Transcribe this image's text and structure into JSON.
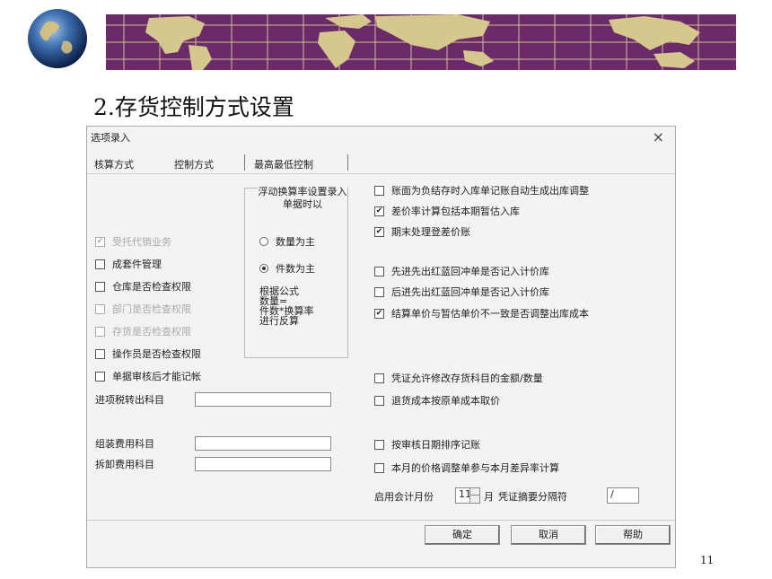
{
  "slide": {
    "title": "2.存货控制方式设置",
    "page_number": "11"
  },
  "dialog": {
    "title": "选项录入",
    "close_glyph": "×",
    "tabs": [
      "核算方式",
      "控制方式",
      "最高最低控制"
    ],
    "active_tab": "控制方式",
    "group_title": "浮动换算率设置录入单据时以",
    "radios": [
      {
        "label": "数量为主",
        "checked": false
      },
      {
        "label": "件数为主",
        "checked": true
      }
    ],
    "formula_text": [
      "根据公式",
      "数量=",
      "件数*换算率",
      "进行反算"
    ],
    "left_checkboxes": [
      {
        "label": "受托代销业务",
        "checked": true,
        "disabled": true
      },
      {
        "label": "成套件管理",
        "checked": false,
        "disabled": false
      },
      {
        "label": "仓库是否检查权限",
        "checked": false,
        "disabled": false
      },
      {
        "label": "部门是否检查权限",
        "checked": false,
        "disabled": true
      },
      {
        "label": "存货是否检查权限",
        "checked": false,
        "disabled": true
      },
      {
        "label": "操作员是否检查权限",
        "checked": false,
        "disabled": false
      },
      {
        "label": "单据审核后才能记帐",
        "checked": false,
        "disabled": false
      }
    ],
    "fields": {
      "tax_transfer_label": "进项税转出科目",
      "assembly_fee_label": "组装费用科目",
      "disassembly_fee_label": "拆卸费用科目"
    },
    "right_checkboxes": [
      {
        "label": "账面为负结存时入库单记账自动生成出库调整",
        "checked": false
      },
      {
        "label": "差价率计算包括本期暂估入库",
        "checked": true
      },
      {
        "label": "期末处理登差价账",
        "checked": true
      },
      {
        "label": "先进先出红蓝回冲单是否记入计价库",
        "checked": false
      },
      {
        "label": "后进先出红蓝回冲单是否记入计价库",
        "checked": false
      },
      {
        "label": "结算单价与暂估单价不一致是否调整出库成本",
        "checked": true
      },
      {
        "label": "凭证允许修改存货科目的金额/数量",
        "checked": false
      },
      {
        "label": "退货成本按原单成本取价",
        "checked": false
      },
      {
        "label": "按审核日期排序记账",
        "checked": false
      },
      {
        "label": "本月的价格调整单参与本月差异率计算",
        "checked": false
      }
    ],
    "start_period": {
      "label": "启用会计月份",
      "value": "11",
      "unit": "月",
      "separator_label": "凭证摘要分隔符",
      "separator_value": "/"
    },
    "buttons": {
      "ok": "确定",
      "cancel": "取消",
      "help": "帮助"
    }
  }
}
